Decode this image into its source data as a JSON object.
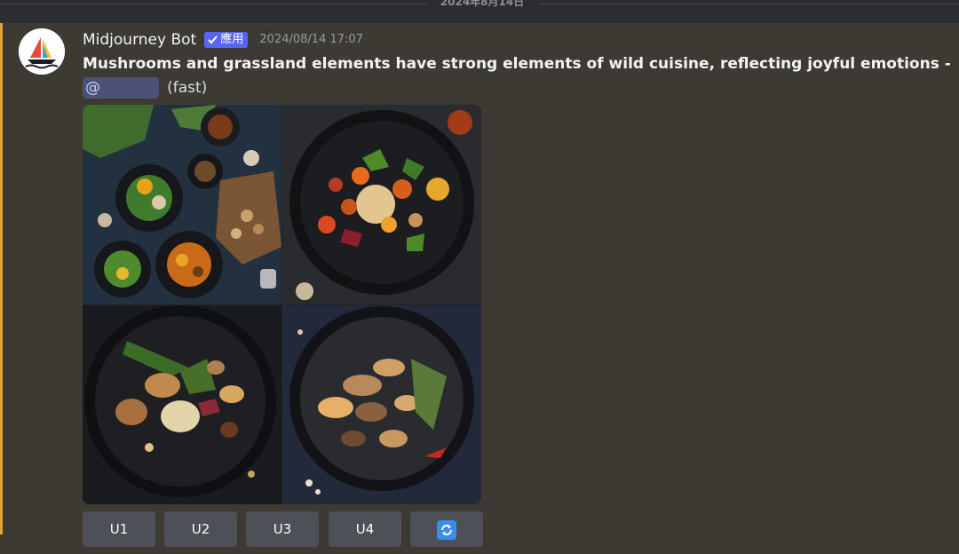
{
  "date_divider": "2024年8月14日",
  "message": {
    "username": "Midjourney Bot",
    "app_badge": "應用",
    "timestamp": "2024/08/14 17:07",
    "prompt": "Mushrooms and grassland elements have strong elements of wild cuisine, reflecting joyful emotions -",
    "mention": "@",
    "speed": "(fast)",
    "image_alt": "Four-image grid of wild mushroom dishes on dark plates",
    "buttons": [
      {
        "label": "U1"
      },
      {
        "label": "U2"
      },
      {
        "label": "U3"
      },
      {
        "label": "U4"
      },
      {
        "icon": "refresh-icon"
      }
    ]
  },
  "colors": {
    "background": "#3c3a33",
    "highlight_bar": "#e2a52f",
    "badge": "#5865f2",
    "button": "#4e5058",
    "mention_bg": "#4c5178"
  }
}
